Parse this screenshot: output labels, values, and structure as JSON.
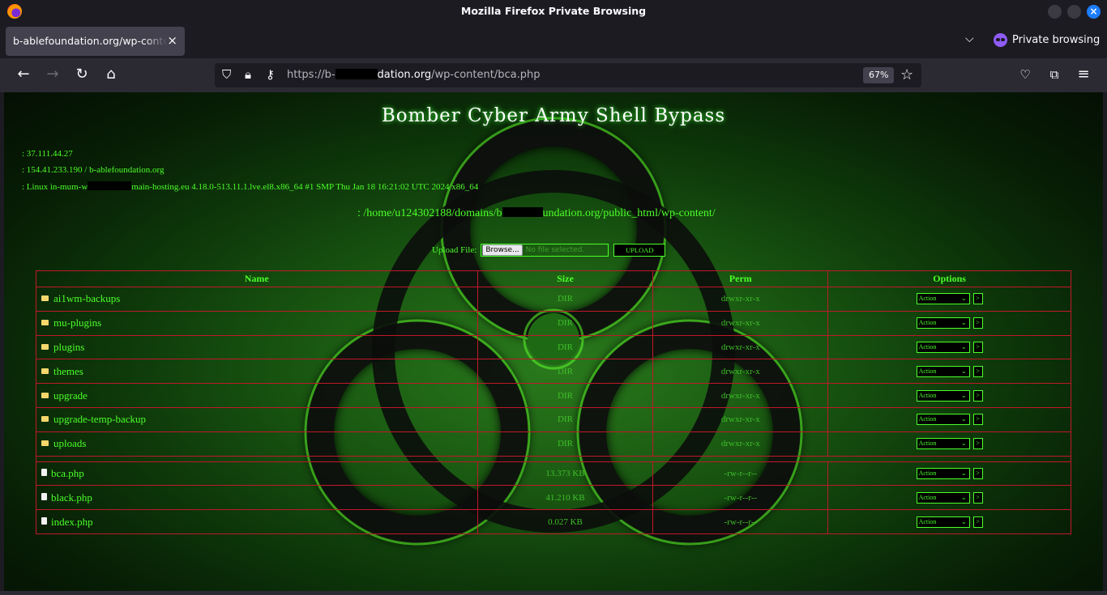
{
  "window": {
    "title": "Mozilla Firefox Private Browsing"
  },
  "tab": {
    "title": "b-ablefoundation.org/wp-content/bca.php",
    "close": "×"
  },
  "tabstrip": {
    "private_label": "Private browsing"
  },
  "navbar": {
    "url_prefix": "https://b-",
    "url_host_rest": "dation.org",
    "url_path": "/wp-content/bca.php",
    "zoom": "67%"
  },
  "shell": {
    "title": "Bomber Cyber Army Shell Bypass",
    "client_ip": ": 37.111.44.27",
    "server_ip": ": 154.41.233.190 / b-ablefoundation.org",
    "uname_prefix": ": Linux in-mum-w",
    "uname_suffix": "main-hosting.eu 4.18.0-513.11.1.lve.el8.x86_64 #1 SMP Thu Jan 18 16:21:02 UTC 2024 x86_64",
    "cwd_prefix": ": /home/u124302188/domains/b",
    "cwd_suffix": "undation.org/public_html/wp-content/",
    "upload_label": "Upload File:",
    "browse_label": "Browse...",
    "no_file_label": "No file selected.",
    "upload_button": "UPLOAD"
  },
  "table": {
    "headers": [
      "Name",
      "Size",
      "Perm",
      "Options"
    ],
    "action_label": "Action",
    "go_label": ">",
    "dirs": [
      {
        "name": "ai1wm-backups",
        "size": "DIR",
        "perm": "drwxr-xr-x"
      },
      {
        "name": "mu-plugins",
        "size": "DIR",
        "perm": "drwxr-xr-x"
      },
      {
        "name": "plugins",
        "size": "DIR",
        "perm": "drwxr-xr-x"
      },
      {
        "name": "themes",
        "size": "DIR",
        "perm": "drwxr-xr-x"
      },
      {
        "name": "upgrade",
        "size": "DIR",
        "perm": "drwxr-xr-x"
      },
      {
        "name": "upgrade-temp-backup",
        "size": "DIR",
        "perm": "drwxr-xr-x"
      },
      {
        "name": "uploads",
        "size": "DIR",
        "perm": "drwxr-xr-x"
      }
    ],
    "files": [
      {
        "name": "bca.php",
        "size": "13.373 KB",
        "perm": "-rw-r--r--"
      },
      {
        "name": "black.php",
        "size": "41.210 KB",
        "perm": "-rw-r--r--"
      },
      {
        "name": "index.php",
        "size": "0.027 KB",
        "perm": "-rw-r--r--"
      }
    ]
  },
  "colors": {
    "accent": "#4cff2a",
    "border": "#c0182a",
    "chrome": "#1c1b22"
  }
}
